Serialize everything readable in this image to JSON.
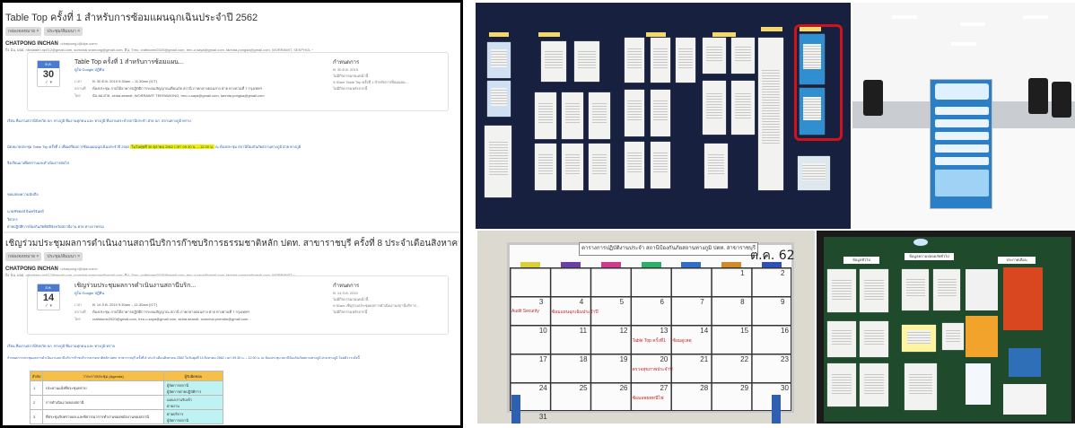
{
  "email1": {
    "subject": "Table Top ครั้งที่ 1 สำหรับการซ้อมแผนฉุกเฉินประจำปี 2562",
    "tags": [
      "กล่องจดหมาย ×",
      "ประชุม/สัมมนา ×"
    ],
    "sender": "CHATPONG INCHAN",
    "sender_email": "<chatpong.i@dpe.com>",
    "recipients": "ถึง ฉัน, ผอฝ, nikhalaen.np012@gmail.com, somchai.sranrong@gmail.com, ติน, Treo, craftdome2520@gmail.com, treo.u.saya@gmail.com, tarinda.pongsa@gmail.com, WORRAWIT, SEKPHOL ~",
    "invite": {
      "month": "ต.ค.",
      "day": "30",
      "title": "Table Top ครั้งที่ 1 สำหรับการซ้อมแผน...",
      "calendar_link": "ดูใน Google ปฏิทิน",
      "rows": [
        {
          "k": "เวลา",
          "v": "พ. 30 ต.ค. 2019 9:30am – 11:30am (ICT)"
        },
        {
          "k": "สถานที่",
          "v": "ห้องประชุม ภายใต้อาคารปฏิบัติการระดมสัญญาณเตือนภัย สถานี ภาคกลางตอนล่าง ฝ่าย ทางด่วนที่ 7 กรุงเทพฯ"
        },
        {
          "k": "ใคร",
          "v": "ฉัน ผอ.ฝ่าย, sirida aeandt, WORRAWIT TEERAWONG, treo.u.saya@gmail.com, tarinda.pongsa@gmail.com"
        }
      ],
      "right_heading": "กำหนดการ",
      "right_date": "พ. 30 ต.ค. 2019",
      "right_lines": [
        "ไม่มีกิจกรรมก่อนหน้านี้",
        "9:30am   Table Top ครั้งที่ 1 สำหรับการซ้อมแผน...",
        "ไม่มีกิจกรรมหลังจากนี้"
      ]
    },
    "body": {
      "greeting": "เรียน ทีมงานสถานีจังหวัด ปภ. ทางภูมิ ทีมงานทุกคน และ ทางภูมิ ทีมงานประจำสถานีประจำ ฝ่าย ปภ. สถานทางภูมิ ทราบ",
      "line_pre": "นัดหมายประชุม Table Top ครั้งที่ 1 เพื่อเตรียมการซ้อมแผนฉุกเฉินประจำปี 2562",
      "line_hl": "ในวันพุธที่ 30 ตุลาคม 2562 เวลา 09.30 น. – 12.00 น.",
      "line_post": "ณ ห้องประชุม สถานีป้องกันภัยสถานทางภูมิ ฝ่าย ทางภูมิ",
      "thanks": "จึงเรียนมาเพื่อทราบและดำเนินการต่อไป",
      "regards": "ขอแสดงความนับถือ",
      "sig1": "นายชัชพงษ์ อินทร์จันทร์",
      "sig2": "วิศวกร",
      "sig3": "ฝ่ายปฏิบัติการป้องกันภัยพิบัติจังหวัดสถานีงาน ฝ่าย ทางภาพรรม"
    }
  },
  "email2": {
    "subject": "เชิญร่วมประชุมผลการดำเนินงานสถานีบริการก๊าซบริการธรรมชาติหลัก ปตท. สาขาราชบุรี ครั้งที่ 8 ประจำเดือนสิงหาคม 2562",
    "tags": [
      "กล่องจดหมาย ×",
      "ประชุม/สัมมนา ×"
    ],
    "sender": "CHATPONG INCHAN",
    "sender_email": "<chatpong.i@dpe.com>",
    "recipients": "ถึง ฉัน, ผอฝ, nikhalaen.np012@gmail.com, somchai.sranrong@gmail.com, ติน, Treo, craftdome2520@gmail.com, treo.u.saya@gmail.com, tarinda.pongsa@gmail.com, WORRAWIT ~",
    "invite": {
      "month": "ส.ค.",
      "day": "14",
      "title": "เชิญร่วมประชุมผลการดำเนินงานสถานีบริก...",
      "calendar_link": "ดูใน Google ปฏิทิน",
      "rows": [
        {
          "k": "เวลา",
          "v": "พ. 14 ส.ค. 2019 9:30am – 11:30am (ICT)"
        },
        {
          "k": "สถานที่",
          "v": "ห้องประชุม ภายใต้อาคารปฏิบัติการระดมสัญญาณ สถานี ภาคกลางตอนล่าง ฝ่าย ทางด่วนที่ 7 กรุงเทพฯ"
        },
        {
          "k": "ใคร",
          "v": "craftdome2520@gmail.com, treo.u.saya@gmail.com, sirida aeandt, somchai.promdin@gmail.com..."
        }
      ],
      "right_heading": "กำหนดการ",
      "right_date": "พ. 14 ส.ค. 2019",
      "right_lines": [
        "ไม่มีกิจกรรมก่อนหน้านี้",
        "9:30am   เชิญร่วมประชุมผลการดำเนินงานสถานีบริการ...",
        "ไม่มีกิจกรรมหลังจากนี้"
      ]
    },
    "body": {
      "greeting": "เรียน ทีมงานสถานีจังหวัด ปภ. ทางภูมิ ทีมงานทุกคน และ ทางภูมิ ทราบ",
      "line": "กำหนดการประชุมผลการดำเนินงานสถานีบริการก๊าซบริการธรรมชาติหลัก ปตท. สาขาราชบุรี ครั้งที่ 8 ประจำเดือนสิงหาคม 2562 ในวันพุธที่ 14 สิงหาคม 2562 เวลา 09.30 น. – 12.00 น. ณ ห้องประชุม สถานีป้องกันภัยสถานทางภูมิ ฝ่าย ทางภูมิ โดยมีวาระดังนี้"
    },
    "table": {
      "headers": [
        "ลำดับ",
        "วาระการประชุม (Agenda)",
        "ผู้รับผิดชอบ"
      ],
      "rows": [
        {
          "no": "1",
          "agenda": "ประธานแจ้งที่ประชุมทราบ",
          "owner": [
            "ผู้จัดการสถานี",
            "ผู้จัดการฝ่ายปฏิบัติการ"
          ]
        },
        {
          "no": "2",
          "agenda": "การดำเนินงานของสถานี",
          "owner": [
            "แผนกงานรับเข้า",
            "ฝ่ายงาน"
          ]
        },
        {
          "no": "3",
          "agenda": "ที่ประชุมรับทราบผล และพิจารณาการทำงานของพนักงานของสถานี",
          "owner": [
            "ฝ่ายบริการ",
            "ผู้จัดการสถานี"
          ]
        }
      ]
    }
  },
  "whiteboard": {
    "title": "ตารางการปฏิบัติงานประจำ สถานีป้องกันภัยสถานทางภูมิ ปตท. สาขาราชบุรี",
    "month": "ต.ค. 62",
    "day_colors": [
      "#d8cf3a",
      "#6a3fa8",
      "#d03a8a",
      "#2fae6a",
      "#2f6fc8",
      "#cf8a2a",
      "#2f4fb8"
    ],
    "numbers": [
      "1",
      "2",
      "3",
      "4",
      "5",
      "6",
      "7",
      "8",
      "9",
      "10",
      "11",
      "12",
      "13",
      "14",
      "15",
      "16",
      "17",
      "18",
      "19",
      "20",
      "21",
      "22",
      "23",
      "24",
      "25",
      "26",
      "27",
      "28",
      "29",
      "30",
      "31"
    ],
    "notes": [
      {
        "cell": "28",
        "text": "Audit Security"
      },
      {
        "cell": "29",
        "text": "ซ้อมแผนฉุกเฉินประจำปี"
      },
      {
        "cell": "38",
        "text": "Table Top ครั้งที่1"
      },
      {
        "cell": "39",
        "text": "ซ้อมดูเหตุ"
      },
      {
        "cell": "45",
        "text": "ตรวจสุขภาพประจำปี"
      },
      {
        "cell": "52",
        "text": "ซ้อมอพยพหนีไฟ"
      }
    ]
  },
  "noticeboard": {
    "headers": [
      "ข้อมูลทั่วไป",
      "ข้อมูลความปลอดภัยทั่วไป",
      "ประกาศเตือน"
    ]
  },
  "colors": {
    "highlight": "#f5f000",
    "link_blue": "#2a5db0",
    "table_header": "#f5c04a",
    "table_cyan": "#bff2f2",
    "red_focus_box": "#d0121b",
    "board_navy": "#17203e",
    "notice_green": "#1f4a2b"
  }
}
